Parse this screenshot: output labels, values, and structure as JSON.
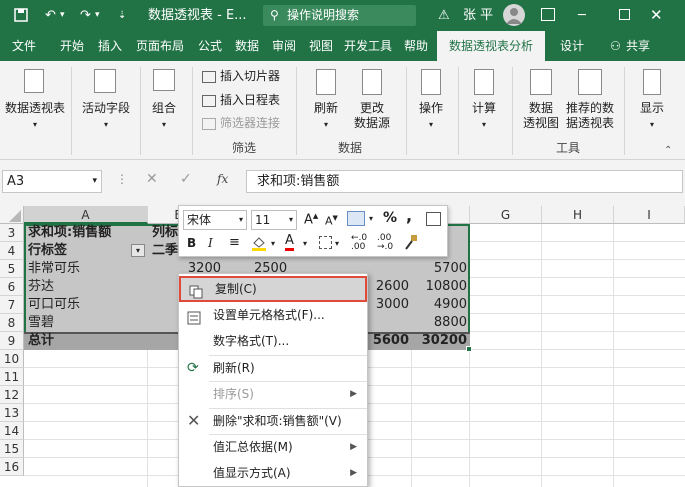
{
  "titlebar": {
    "doc_title": "数据透视表 - E...",
    "search_text": "操作说明搜索",
    "user_name": "张 平",
    "colors": {
      "bg": "#217346"
    }
  },
  "tabs": [
    "文件",
    "开始",
    "插入",
    "页面布局",
    "公式",
    "数据",
    "审阅",
    "视图",
    "开发工具",
    "帮助",
    "数据透视表分析",
    "设计",
    "共享"
  ],
  "ribbon": {
    "buttons": {
      "pivot": "数据透视表",
      "active_field": "活动字段",
      "group": "组合",
      "insert_slicer": "插入切片器",
      "insert_timeline": "插入日程表",
      "filter_conn": "筛选器连接",
      "refresh": "刷新",
      "change_source": "更改\n数据源",
      "actions": "操作",
      "calc": "计算",
      "pivot_chart": "数据\n透视图",
      "recommended": "推荐的数\n据透视表",
      "show": "显示"
    },
    "groups": {
      "filter": "筛选",
      "data": "数据",
      "tools": "工具"
    }
  },
  "formula": {
    "name_box": "A3",
    "fx": "fx",
    "value": "求和项:销售额"
  },
  "columns": [
    "A",
    "B",
    "C",
    "D",
    "E",
    "F",
    "G",
    "H",
    "I"
  ],
  "rows": [
    "3",
    "4",
    "5",
    "6",
    "7",
    "8",
    "9",
    "10",
    "11",
    "12",
    "13",
    "14",
    "15",
    "16"
  ],
  "cells": {
    "a3": "求和项:销售额",
    "b3": "列标",
    "a4": "行标签",
    "b4": "二季",
    "a5": "非常可乐",
    "b5": "3200",
    "c5": "2500",
    "f5": "5700",
    "a6": "芬达",
    "e6": "2600",
    "f6": "10800",
    "a7": "可口可乐",
    "e7": "3000",
    "f7": "4900",
    "a8": "雪碧",
    "f8": "8800",
    "a9": "总计",
    "e9": "5600",
    "f9": "30200"
  },
  "mini_toolbar": {
    "font": "宋体",
    "size": "11",
    "percent": "%",
    "comma": ","
  },
  "context_menu": [
    {
      "label": "复制(C)",
      "icon": "copy-icon",
      "disabled": false,
      "submenu": false
    },
    {
      "label": "设置单元格格式(F)...",
      "icon": "format-cells-icon",
      "disabled": false,
      "submenu": false
    },
    {
      "label": "数字格式(T)...",
      "icon": "",
      "disabled": false,
      "submenu": false
    },
    {
      "label": "刷新(R)",
      "icon": "refresh-icon",
      "disabled": false,
      "submenu": false
    },
    {
      "label": "排序(S)",
      "icon": "",
      "disabled": true,
      "submenu": true
    },
    {
      "label": "删除\"求和项:销售额\"(V)",
      "icon": "close-icon",
      "disabled": false,
      "submenu": false
    },
    {
      "label": "值汇总依据(M)",
      "icon": "",
      "disabled": false,
      "submenu": true
    },
    {
      "label": "值显示方式(A)",
      "icon": "",
      "disabled": false,
      "submenu": true
    }
  ]
}
